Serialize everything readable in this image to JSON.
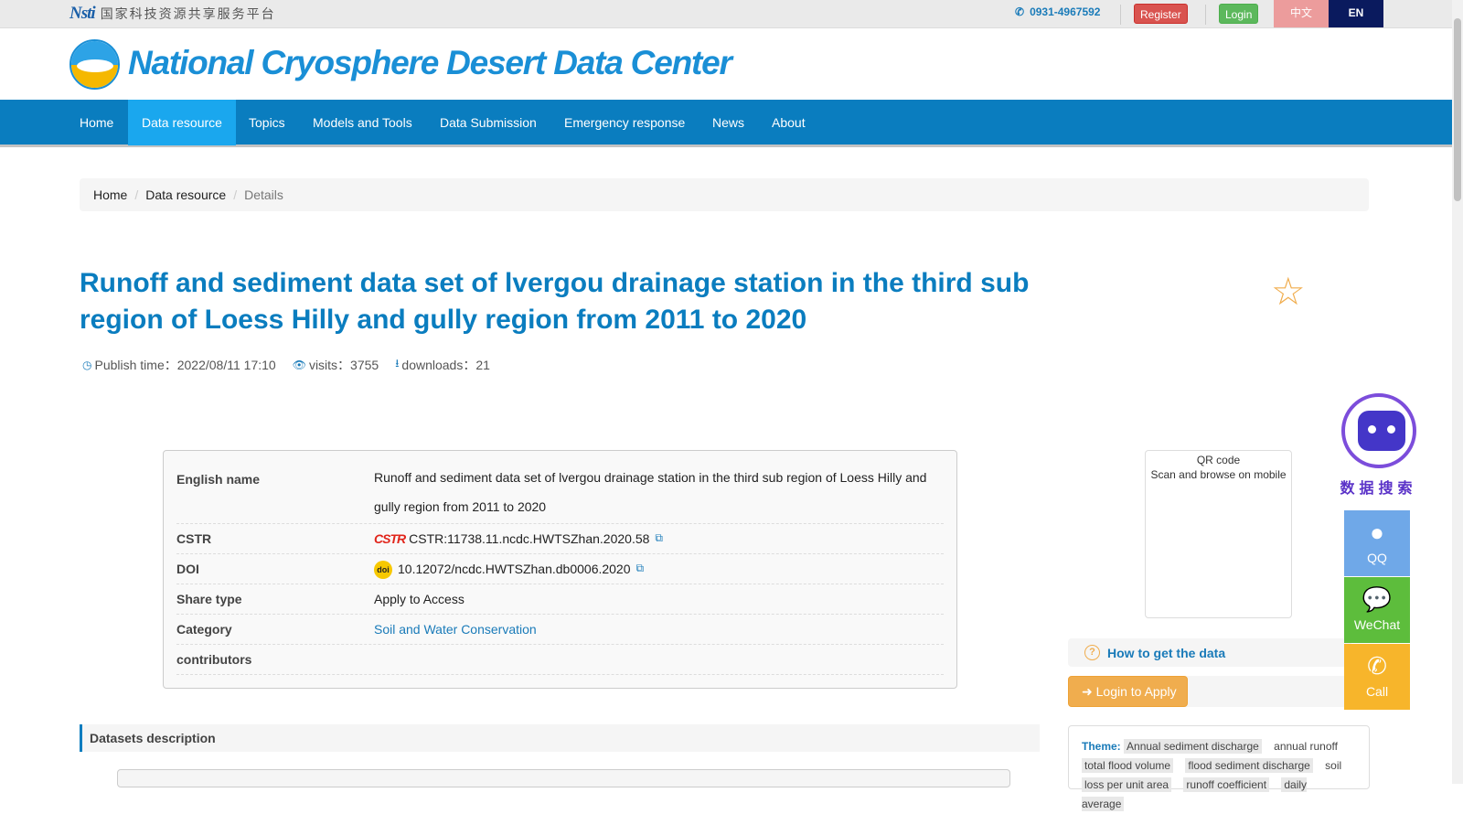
{
  "topbar": {
    "nsti_logo": "Nsti",
    "nsti_text": "国家科技资源共享服务平台",
    "phone": "0931-4967592",
    "register_label": "Register",
    "login_label": "Login",
    "lang_zh": "中文",
    "lang_en": "EN"
  },
  "header": {
    "site_title": "National Cryosphere Desert Data Center"
  },
  "nav": {
    "items": [
      {
        "label": "Home"
      },
      {
        "label": "Data resource"
      },
      {
        "label": "Topics"
      },
      {
        "label": "Models and Tools"
      },
      {
        "label": "Data Submission"
      },
      {
        "label": "Emergency response"
      },
      {
        "label": "News"
      },
      {
        "label": "About"
      }
    ],
    "active": "Data resource"
  },
  "breadcrumb": {
    "home": "Home",
    "section": "Data resource",
    "current": "Details"
  },
  "dataset": {
    "title": "Runoff and sediment data set of lvergou drainage station in the third sub region of Loess Hilly and gully region from 2011 to 2020",
    "publish_time": "Publish time：2022/08/11 17:10",
    "visits": "visits：3755",
    "downloads": "downloads：21",
    "fields": {
      "english_name_label": "English name",
      "english_name": "Runoff and sediment data set of lvergou drainage station in the third sub region of Loess Hilly and gully region from 2011 to 2020",
      "cstr_label": "CSTR",
      "cstr_logo": "CSTR",
      "cstr": "CSTR:11738.11.ncdc.HWTSZhan.2020.58",
      "doi_label": "DOI",
      "doi_logo": "doi",
      "doi": "10.12072/ncdc.HWTSZhan.db0006.2020",
      "share_type_label": "Share type",
      "share_type": "Apply to Access",
      "category_label": "Category",
      "category": "Soil and Water Conservation",
      "contributors_label": "contributors",
      "contributors": ""
    },
    "description_title": "Datasets description"
  },
  "sidebar": {
    "qr_alt": "QR code",
    "qr_caption": "Scan and browse on mobile",
    "howto_label": "How to get the data",
    "apply_label": "Login to Apply",
    "theme_label": "Theme:",
    "theme_tags": [
      "Annual sediment discharge",
      "annual runoff",
      "total flood volume",
      "flood sediment discharge",
      "soil",
      "loss per unit area",
      "runoff coefficient",
      "daily average"
    ]
  },
  "floating": {
    "robot_text": "数据搜索",
    "qq_label": "QQ",
    "wechat_label": "WeChat",
    "call_label": "Call"
  },
  "colors": {
    "primary": "#0a7dbf",
    "nav_active": "#1aa7ee",
    "register": "#d9534f",
    "login": "#5cb85c",
    "apply": "#f0ad4e"
  }
}
